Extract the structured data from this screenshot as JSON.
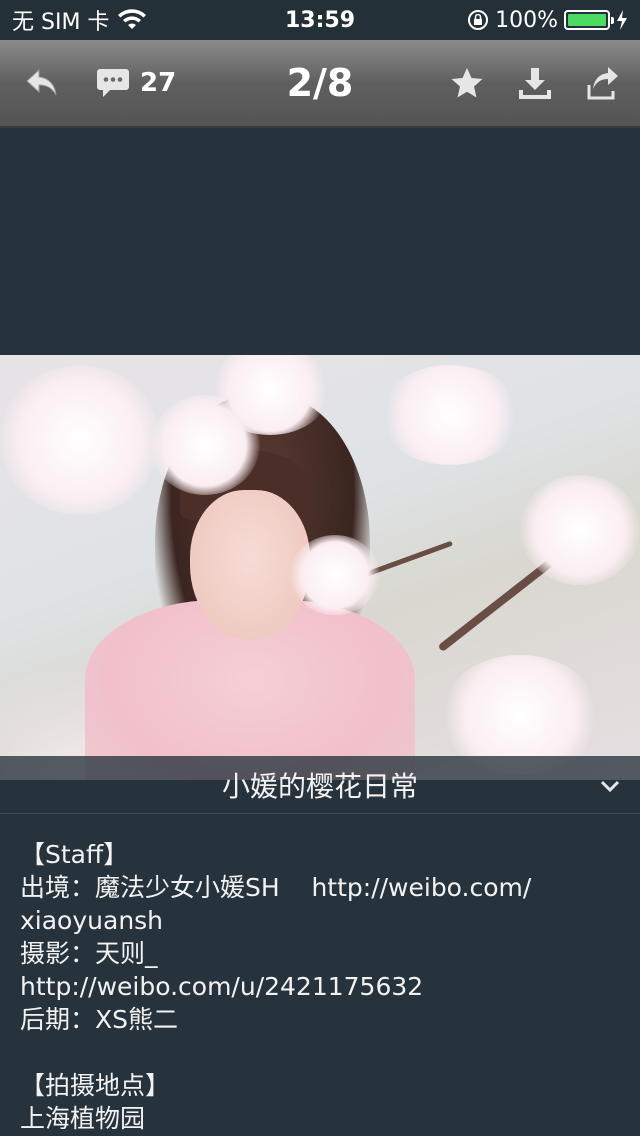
{
  "status_bar": {
    "carrier": "无 SIM 卡",
    "time": "13:59",
    "battery": "100%"
  },
  "toolbar": {
    "comment_count": "27",
    "page_indicator": "2/8"
  },
  "caption": {
    "title": "小媛的樱花日常"
  },
  "description": {
    "lines": [
      "【Staff】",
      "出境：魔法少女小媛SH    http://weibo.com/",
      "xiaoyuansh",
      "摄影：天则_",
      "http://weibo.com/u/2421175632",
      "后期：XS熊二",
      "",
      "【拍摄地点】",
      "上海植物园"
    ]
  },
  "icons": {
    "back": "back-arrow-icon",
    "comments": "speech-bubble-icon",
    "favorite": "star-icon",
    "download": "download-icon",
    "share": "share-icon",
    "caption_toggle": "chevron-down-icon"
  },
  "colors": {
    "battery": "#4cd964",
    "background": "#26333c"
  }
}
